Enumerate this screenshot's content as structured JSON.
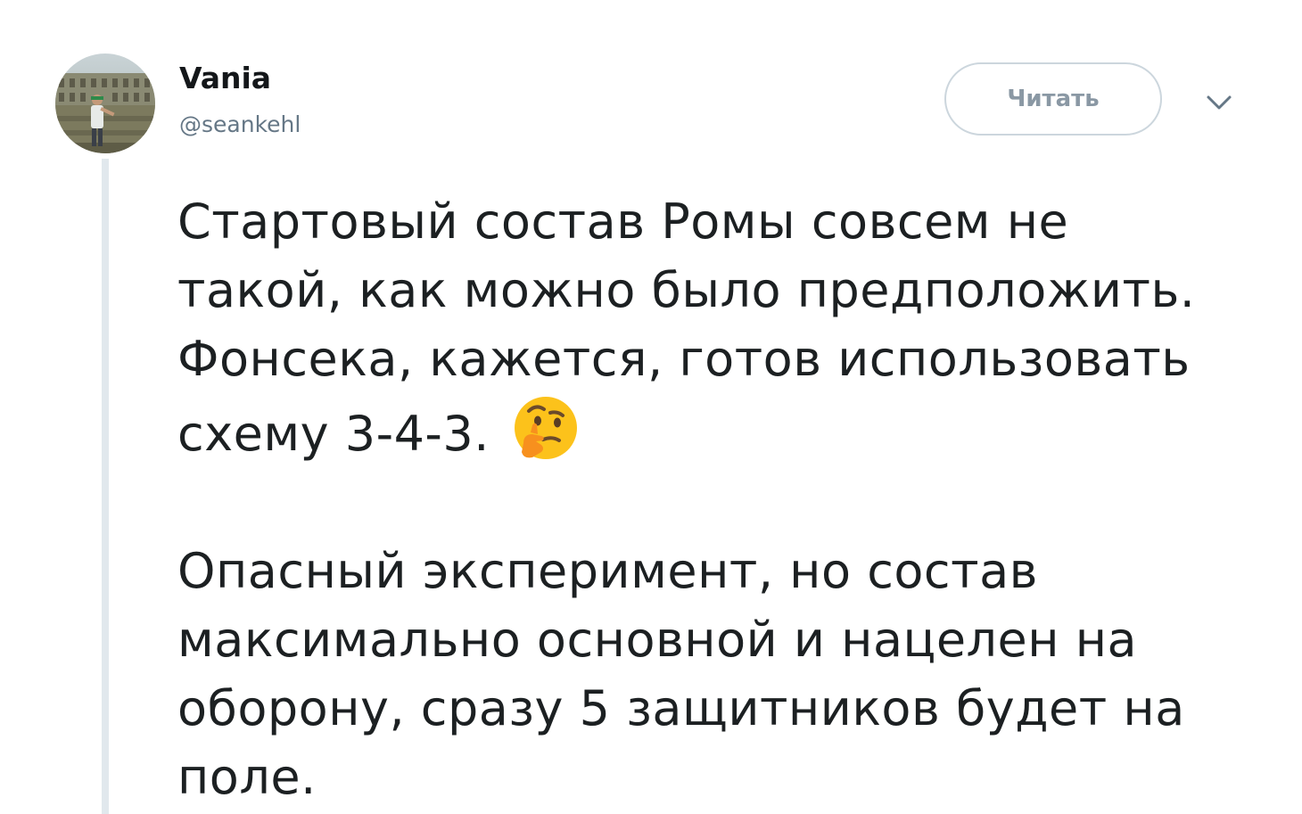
{
  "author": {
    "display_name": "Vania",
    "handle": "@seankehl",
    "avatar_icon": "avatar-photo"
  },
  "actions": {
    "follow_label": "Читать",
    "menu_icon": "chevron-down-icon"
  },
  "tweet": {
    "paragraph1": {
      "line1": "Стартовый состав Ромы совсем не",
      "line2": "такой, как можно было предположить.",
      "line3": "Фонсека, кажется, готов использовать",
      "line4": "схему 3-4-3.",
      "emoji": "thinking-face-emoji"
    },
    "paragraph2": {
      "line1": "Опасный эксперимент, но состав",
      "line2": "максимально основной и нацелен на",
      "line3": "оборону, сразу 5 защитников будет на",
      "line4": "поле."
    }
  },
  "colors": {
    "text": "#1c2022",
    "secondary": "#657786",
    "border": "#ccd6dd",
    "thread_line": "#e1e8ed"
  }
}
